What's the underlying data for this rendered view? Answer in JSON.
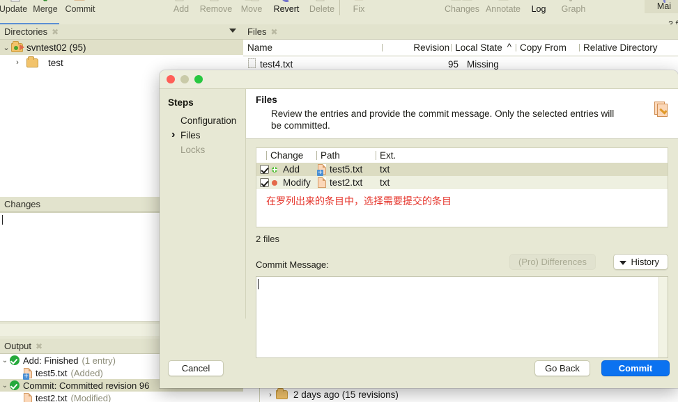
{
  "toolbar": {
    "items": [
      {
        "label": "Update",
        "icon": "update-icon",
        "state": "enabled"
      },
      {
        "label": "Merge",
        "icon": "merge-icon",
        "state": "enabled"
      },
      {
        "label": "Commit",
        "icon": "commit-icon",
        "state": "enabled"
      },
      {
        "label": "Add",
        "icon": "add-icon",
        "state": "disabled"
      },
      {
        "label": "Remove",
        "icon": "remove-icon",
        "state": "disabled"
      },
      {
        "label": "Move",
        "icon": "move-icon",
        "state": "disabled"
      },
      {
        "label": "Revert",
        "icon": "revert-icon",
        "state": "enabled"
      },
      {
        "label": "Delete",
        "icon": "delete-icon",
        "state": "disabled"
      },
      {
        "label": "Fix",
        "icon": "fix-icon",
        "state": "disabled"
      },
      {
        "label": "Changes",
        "icon": "changes-icon",
        "state": "disabled"
      },
      {
        "label": "Annotate",
        "icon": "annotate-icon",
        "state": "disabled"
      },
      {
        "label": "Log",
        "icon": "log-icon",
        "state": "enabled"
      },
      {
        "label": "Graph",
        "icon": "graph-icon",
        "state": "disabled"
      }
    ],
    "main_tab": "Mai",
    "files_count": "3 f"
  },
  "directories_panel": {
    "title": "Directories",
    "close_glyph": "✖",
    "tree": [
      {
        "label": "svntest02 (95)",
        "twisty": "⌄",
        "selected": true,
        "depth": 0,
        "icon": "repo-folder-icon"
      },
      {
        "label": "test",
        "twisty": "›",
        "selected": false,
        "depth": 1,
        "icon": "folder-icon"
      }
    ]
  },
  "changes_panel": {
    "title": "Changes"
  },
  "output_panel": {
    "title": "Output",
    "close_glyph": "✖",
    "rows": [
      {
        "twisty": "⌄",
        "status": "ok",
        "text": "Add: Finished",
        "note": "(1 entry)",
        "indent": 0,
        "selected": false,
        "icon": "success-icon"
      },
      {
        "twisty": "",
        "status": "file-add",
        "text": "test5.txt",
        "note": "(Added)",
        "indent": 1,
        "selected": false,
        "icon": "file-added-icon"
      },
      {
        "twisty": "⌄",
        "status": "ok",
        "text": "Commit: Committed revision 96",
        "note": "",
        "indent": 0,
        "selected": true,
        "icon": "success-icon"
      },
      {
        "twisty": "",
        "status": "file-mod",
        "text": "test2.txt",
        "note": "(Modified)",
        "indent": 1,
        "selected": false,
        "icon": "file-modified-icon"
      }
    ]
  },
  "files_panel": {
    "title": "Files",
    "close_glyph": "✖",
    "columns": [
      "Name",
      "Revision",
      "Local State",
      "Copy From",
      "Relative Directory"
    ],
    "sort_indicator": "^",
    "rows": [
      {
        "name": "test4.txt",
        "revision": "95",
        "local_state": "Missing",
        "copy_from": "",
        "relative_directory": ""
      }
    ],
    "history_row": "2 days ago (15 revisions)"
  },
  "dialog": {
    "window_controls": [
      "close",
      "minimize",
      "zoom"
    ],
    "steps_title": "Steps",
    "steps": [
      {
        "label": "Configuration",
        "state": "done"
      },
      {
        "label": "Files",
        "state": "current"
      },
      {
        "label": "Locks",
        "state": "disabled"
      }
    ],
    "heading": "Files",
    "description": "Review the entries and provide the commit message. Only the selected entries will be committed.",
    "header_icon": "commit-pages-icon",
    "table": {
      "columns": [
        "",
        "Change",
        "Path",
        "Ext.",
        ""
      ],
      "rows": [
        {
          "checked": true,
          "change": "Add",
          "change_kind": "add",
          "path": "test5.txt",
          "ext": "txt",
          "selected": true,
          "icon": "file-added-icon"
        },
        {
          "checked": true,
          "change": "Modify",
          "change_kind": "modify",
          "path": "test2.txt",
          "ext": "txt",
          "selected": false,
          "icon": "file-modified-icon"
        }
      ],
      "annotation": "在罗列出来的条目中，选择需要提交的条目",
      "annotation_color": "#e5332a"
    },
    "file_count_label": "2 files",
    "commit_message_label": "Commit Message:",
    "commit_message_value": "",
    "differences_button": "(Pro) Differences",
    "history_button": "History",
    "cancel_button": "Cancel",
    "go_back_button": "Go Back",
    "commit_button": "Commit",
    "accent_color": "#0b72f0"
  }
}
